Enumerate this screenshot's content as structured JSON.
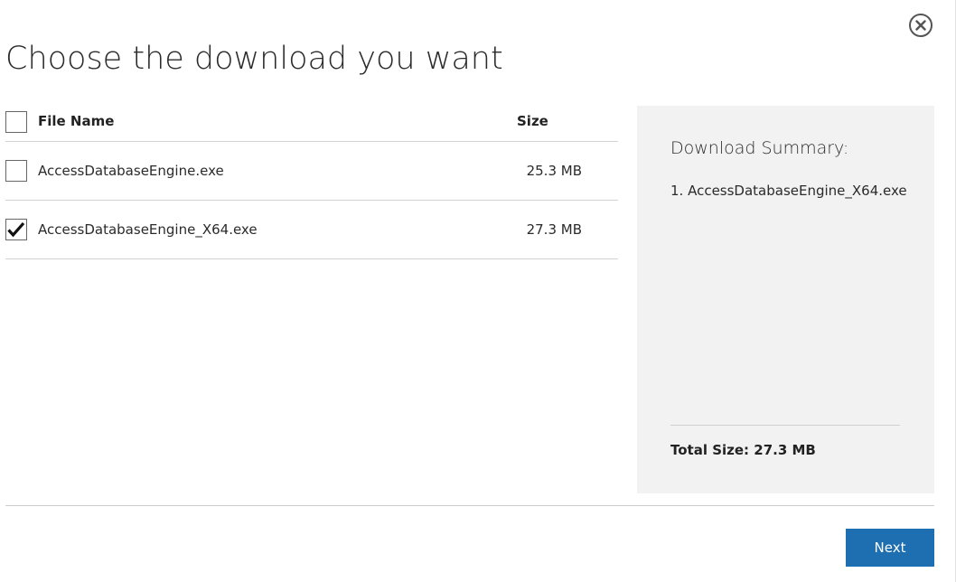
{
  "dialog": {
    "title": "Choose the download you want",
    "close_icon": "close-circle-icon"
  },
  "table": {
    "headers": {
      "name": "File Name",
      "size": "Size"
    },
    "select_all_checked": false,
    "rows": [
      {
        "name": "AccessDatabaseEngine.exe",
        "size": "25.3 MB",
        "checked": false
      },
      {
        "name": "AccessDatabaseEngine_X64.exe",
        "size": "27.3 MB",
        "checked": true
      }
    ]
  },
  "summary": {
    "title": "Download Summary:",
    "items": [
      "1. AccessDatabaseEngine_X64.exe"
    ],
    "total": "Total Size: 27.3 MB"
  },
  "footer": {
    "next_label": "Next"
  },
  "colors": {
    "accent": "#1e6fb1",
    "panel_bg": "#f2f2f2",
    "divider": "#d3d3d3"
  }
}
